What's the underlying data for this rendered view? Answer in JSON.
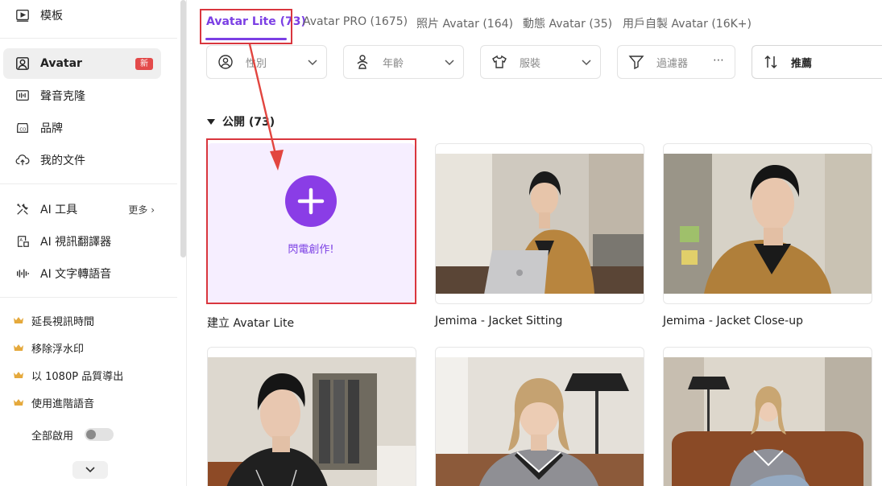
{
  "sidebar": {
    "items": [
      {
        "label": "模板",
        "icon": "template-icon"
      },
      {
        "label": "Avatar",
        "icon": "avatar-icon",
        "badge": "新",
        "active": true
      },
      {
        "label": "聲音克隆",
        "icon": "voice-clone-icon"
      },
      {
        "label": "品牌",
        "icon": "brand-icon"
      },
      {
        "label": "我的文件",
        "icon": "upload-cloud-icon"
      }
    ],
    "tools": [
      {
        "label": "AI 工具",
        "icon": "tools-icon",
        "more": "更多"
      },
      {
        "label": "AI 視訊翻譯器",
        "icon": "video-translate-icon"
      },
      {
        "label": "AI 文字轉語音",
        "icon": "text-to-speech-icon"
      }
    ],
    "premium": [
      {
        "label": "延長視訊時間",
        "icon": "crown-icon"
      },
      {
        "label": "移除浮水印",
        "icon": "crown-icon"
      },
      {
        "label": "以 1080P 品質導出",
        "icon": "crown-icon"
      },
      {
        "label": "使用進階語音",
        "icon": "crown-icon"
      }
    ],
    "enable_all": "全部啟用",
    "enable_all_on": false
  },
  "tabs": [
    {
      "label": "Avatar Lite (73)",
      "active": true
    },
    {
      "label": "Avatar PRO (1675)"
    },
    {
      "label": "照片 Avatar (164)"
    },
    {
      "label": "動態 Avatar (35)"
    },
    {
      "label": "用戶自製 Avatar (16K+)"
    }
  ],
  "filters": {
    "gender": "性別",
    "age": "年齡",
    "clothing": "服裝",
    "filter": "過濾器",
    "sort": "推薦"
  },
  "section": {
    "label": "公開 (73)"
  },
  "create_card": {
    "button_label": "閃電創作!",
    "title": "建立 Avatar Lite"
  },
  "avatars": [
    {
      "title": "Jemima - Jacket Sitting"
    },
    {
      "title": "Jemima - Jacket Close-up"
    },
    {
      "title": ""
    },
    {
      "title": ""
    },
    {
      "title": ""
    }
  ],
  "colors": {
    "accent": "#7b3fe4",
    "annotation": "#d9363e",
    "badge": "#e34a4a",
    "crown": "#e5a93c"
  }
}
